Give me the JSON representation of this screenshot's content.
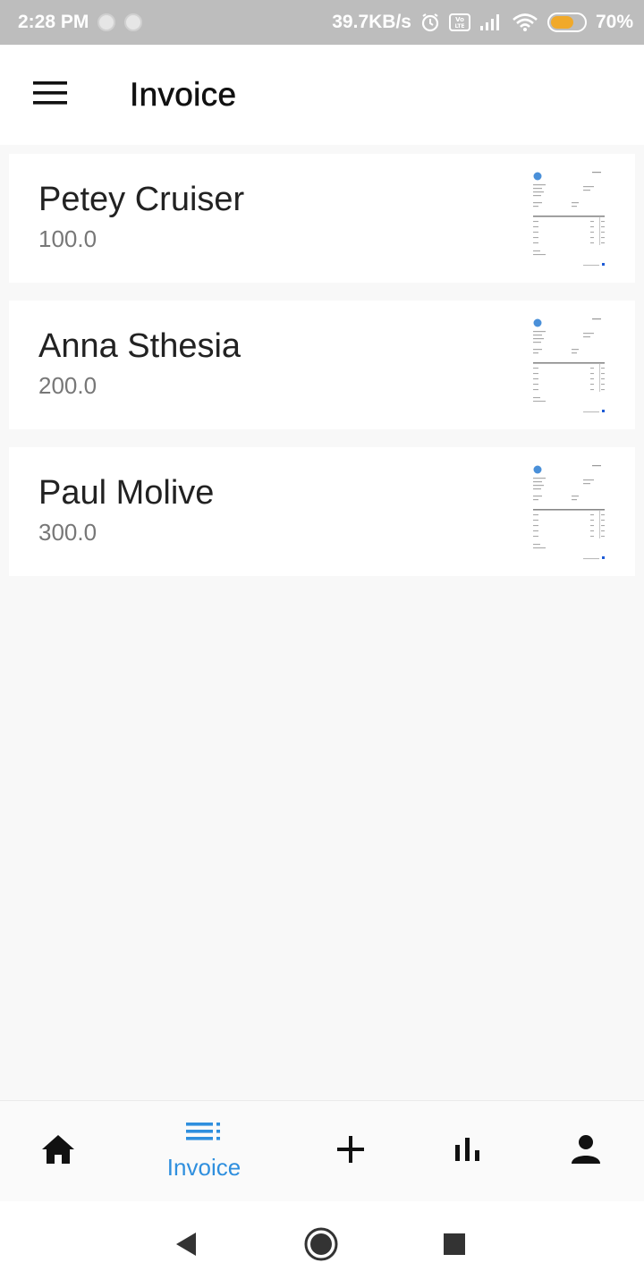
{
  "status_bar": {
    "time": "2:28 PM",
    "network_speed": "39.7KB/s",
    "battery_percent": "70%",
    "battery_level": 0.7,
    "icons": [
      "alarm-icon",
      "volte-icon",
      "signal-icon",
      "wifi-icon",
      "battery-icon"
    ]
  },
  "app_bar": {
    "title": "Invoice",
    "menu_icon": "hamburger-menu-icon"
  },
  "invoices": [
    {
      "name": "Petey Cruiser",
      "amount": "100.0"
    },
    {
      "name": "Anna Sthesia",
      "amount": "200.0"
    },
    {
      "name": "Paul Molive",
      "amount": "300.0"
    }
  ],
  "bottom_nav": {
    "items": [
      {
        "icon": "home-icon",
        "label": ""
      },
      {
        "icon": "list-icon",
        "label": "Invoice",
        "active": true
      },
      {
        "icon": "plus-icon",
        "label": ""
      },
      {
        "icon": "bar-chart-icon",
        "label": ""
      },
      {
        "icon": "person-icon",
        "label": ""
      }
    ],
    "active_color": "#2f8fde"
  },
  "system_nav": {
    "icons": [
      "back-icon",
      "home-circle-icon",
      "recents-icon"
    ]
  }
}
